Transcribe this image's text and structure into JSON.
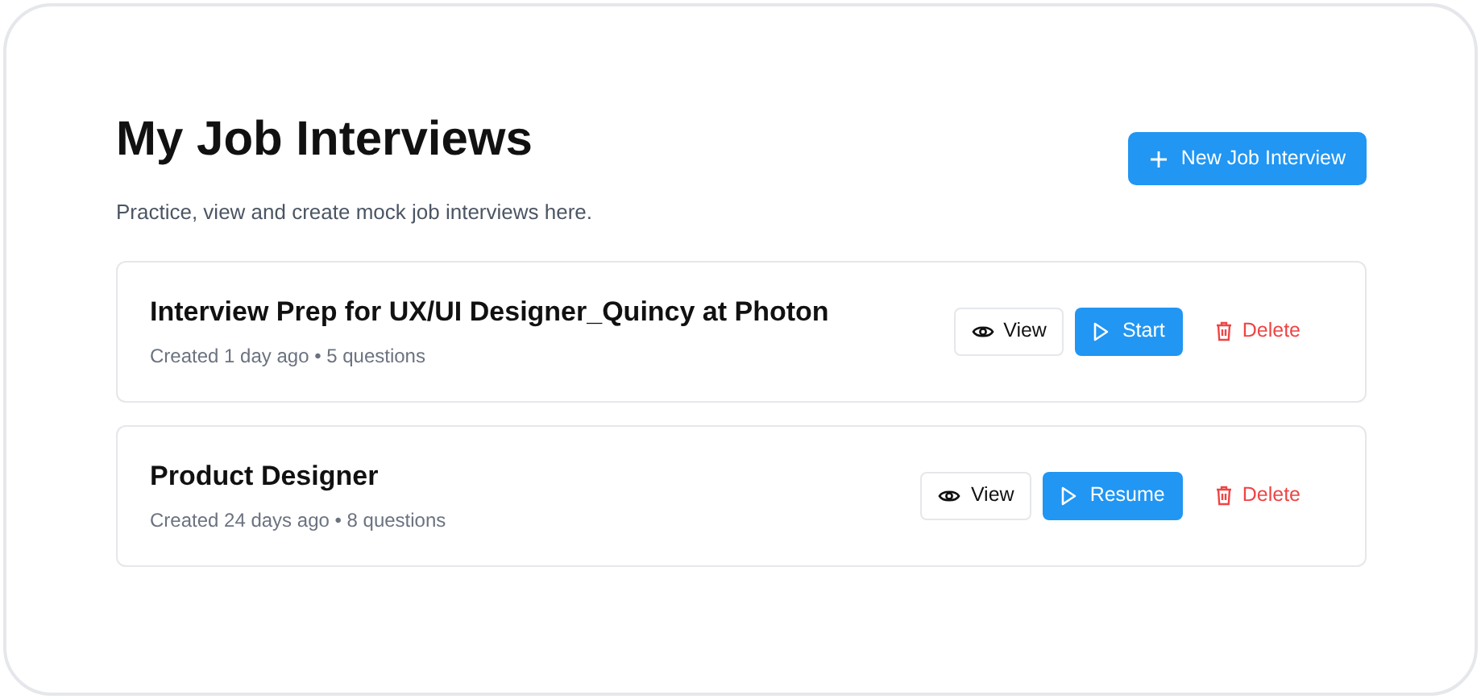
{
  "header": {
    "title": "My Job Interviews",
    "subtitle": "Practice, view and create mock job interviews here.",
    "new_button": "New Job Interview"
  },
  "interviews": [
    {
      "title": "Interview Prep for UX/UI Designer_Quincy at Photon",
      "meta": "Created 1 day ago • 5 questions",
      "view": "View",
      "primary": "Start",
      "delete": "Delete"
    },
    {
      "title": "Product Designer",
      "meta": "Created 24 days ago • 8 questions",
      "view": "View",
      "primary": "Resume",
      "delete": "Delete"
    }
  ]
}
